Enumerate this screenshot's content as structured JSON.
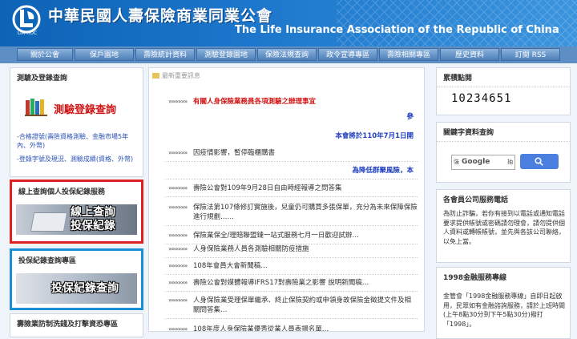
{
  "header": {
    "logo_text": "LIA-ROC",
    "title_zh": "中華民國人壽保險商業同業公會",
    "title_en": "The Life Insurance Association of the Republic of China"
  },
  "nav": [
    "關於公會",
    "保戶園地",
    "壽險統計資料",
    "測驗登錄園地",
    "保險法規查詢",
    "政令宣導專區",
    "壽險相關專區",
    "歷史資料",
    "訂閱 RSS"
  ],
  "left": {
    "box1_title": "測驗及登錄查詢",
    "exam_link": "測驗登錄查詢",
    "link1": "-合格證號(壽險資格測驗、金融市場5年內、外幣)",
    "link2": "-登錄字號及現況、測驗成績(資格、外幣)",
    "box2_title": "線上查詢個人投保紀錄服務",
    "box2_banner": [
      "線上查詢",
      "投保紀錄"
    ],
    "box3_title": "投保紀錄查詢專區",
    "box3_banner": "投保紀錄查詢",
    "box4_title": "壽險業防制洗錢及打擊資恐專區"
  },
  "center": {
    "section_title": "最新重要訊息",
    "news": [
      {
        "arrows": "»»»»»»",
        "text": "有關人身保險業務員各項測驗之辦理事宜",
        "color": "#d11414"
      },
      {
        "arrows": "",
        "text": "參",
        "color": "#1f3fbf",
        "right": true
      },
      {
        "arrows": "",
        "text": "本會將於110年7月1日開",
        "color": "#1f3fbf",
        "right": true
      },
      {
        "arrows": "»»»»»»",
        "text": "因疫情影響，暫停臨櫃購書",
        "color": "#333"
      },
      {
        "arrows": "",
        "text": "為降低群聚風險，本",
        "color": "#1f3fbf",
        "right": true
      },
      {
        "arrows": "»»»»»»",
        "text": "壽險公會對109年9月28日自由時經報導之問答集",
        "color": "#333"
      },
      {
        "arrows": "»»»»»»",
        "text": "保險法第107條修訂實施後，兒童仍可購買多張保單，充分為未來保障保險進行規劃……",
        "color": "#333"
      },
      {
        "arrows": "»»»»»»",
        "text": "保險業保全/理賠聯盟鏈一站式服務七月一日歡迎試辦…",
        "color": "#333"
      },
      {
        "arrows": "»»»»»»",
        "text": "人身保險業務人員各測驗相關防疫措施",
        "color": "#333"
      },
      {
        "arrows": "»»»»»»",
        "text": "108年會員大會新聞稿…",
        "color": "#333"
      },
      {
        "arrows": "»»»»»»",
        "text": "壽險公會對媒體報導IFRS17對壽險業之影響 說明新聞稿…",
        "color": "#333"
      },
      {
        "arrows": "»»»»»»",
        "text": "人身保險業受理保單繼承、終止保險契約或申領身故保險金徵提文件及相關問答集…",
        "color": "#333"
      },
      {
        "arrows": "»»»»»»",
        "text": "108年度人身保險業優秀從業人員表揚名單…",
        "color": "#333"
      }
    ]
  },
  "right": {
    "counter_title": "累積點閱",
    "counter": "10234651",
    "keyword_title": "關鍵字資料查詢",
    "google_label": "Google",
    "google_pre": "強",
    "google_post": "抽",
    "phone_title": "各會員公司服務電話",
    "phone_text": "為防止詐騙，若你有接到以電話或通知電話要求提供帳號或密碼請勿理會，請勿提供個人資料或轉帳帳號，並先與各該公司聯絡，以免上當。",
    "svc_title": "1998金融服務專線",
    "svc_text": "金管會「1998金融服務專線」自即日起啟用，民眾如有金融諮詢服務，請於上班時間(上午8點30分到下午5點30分)撥打「1998」。"
  },
  "colors": {
    "brand_blue": "#1d77cc",
    "alert_red": "#d11414",
    "link_blue": "#1f3fbf"
  }
}
